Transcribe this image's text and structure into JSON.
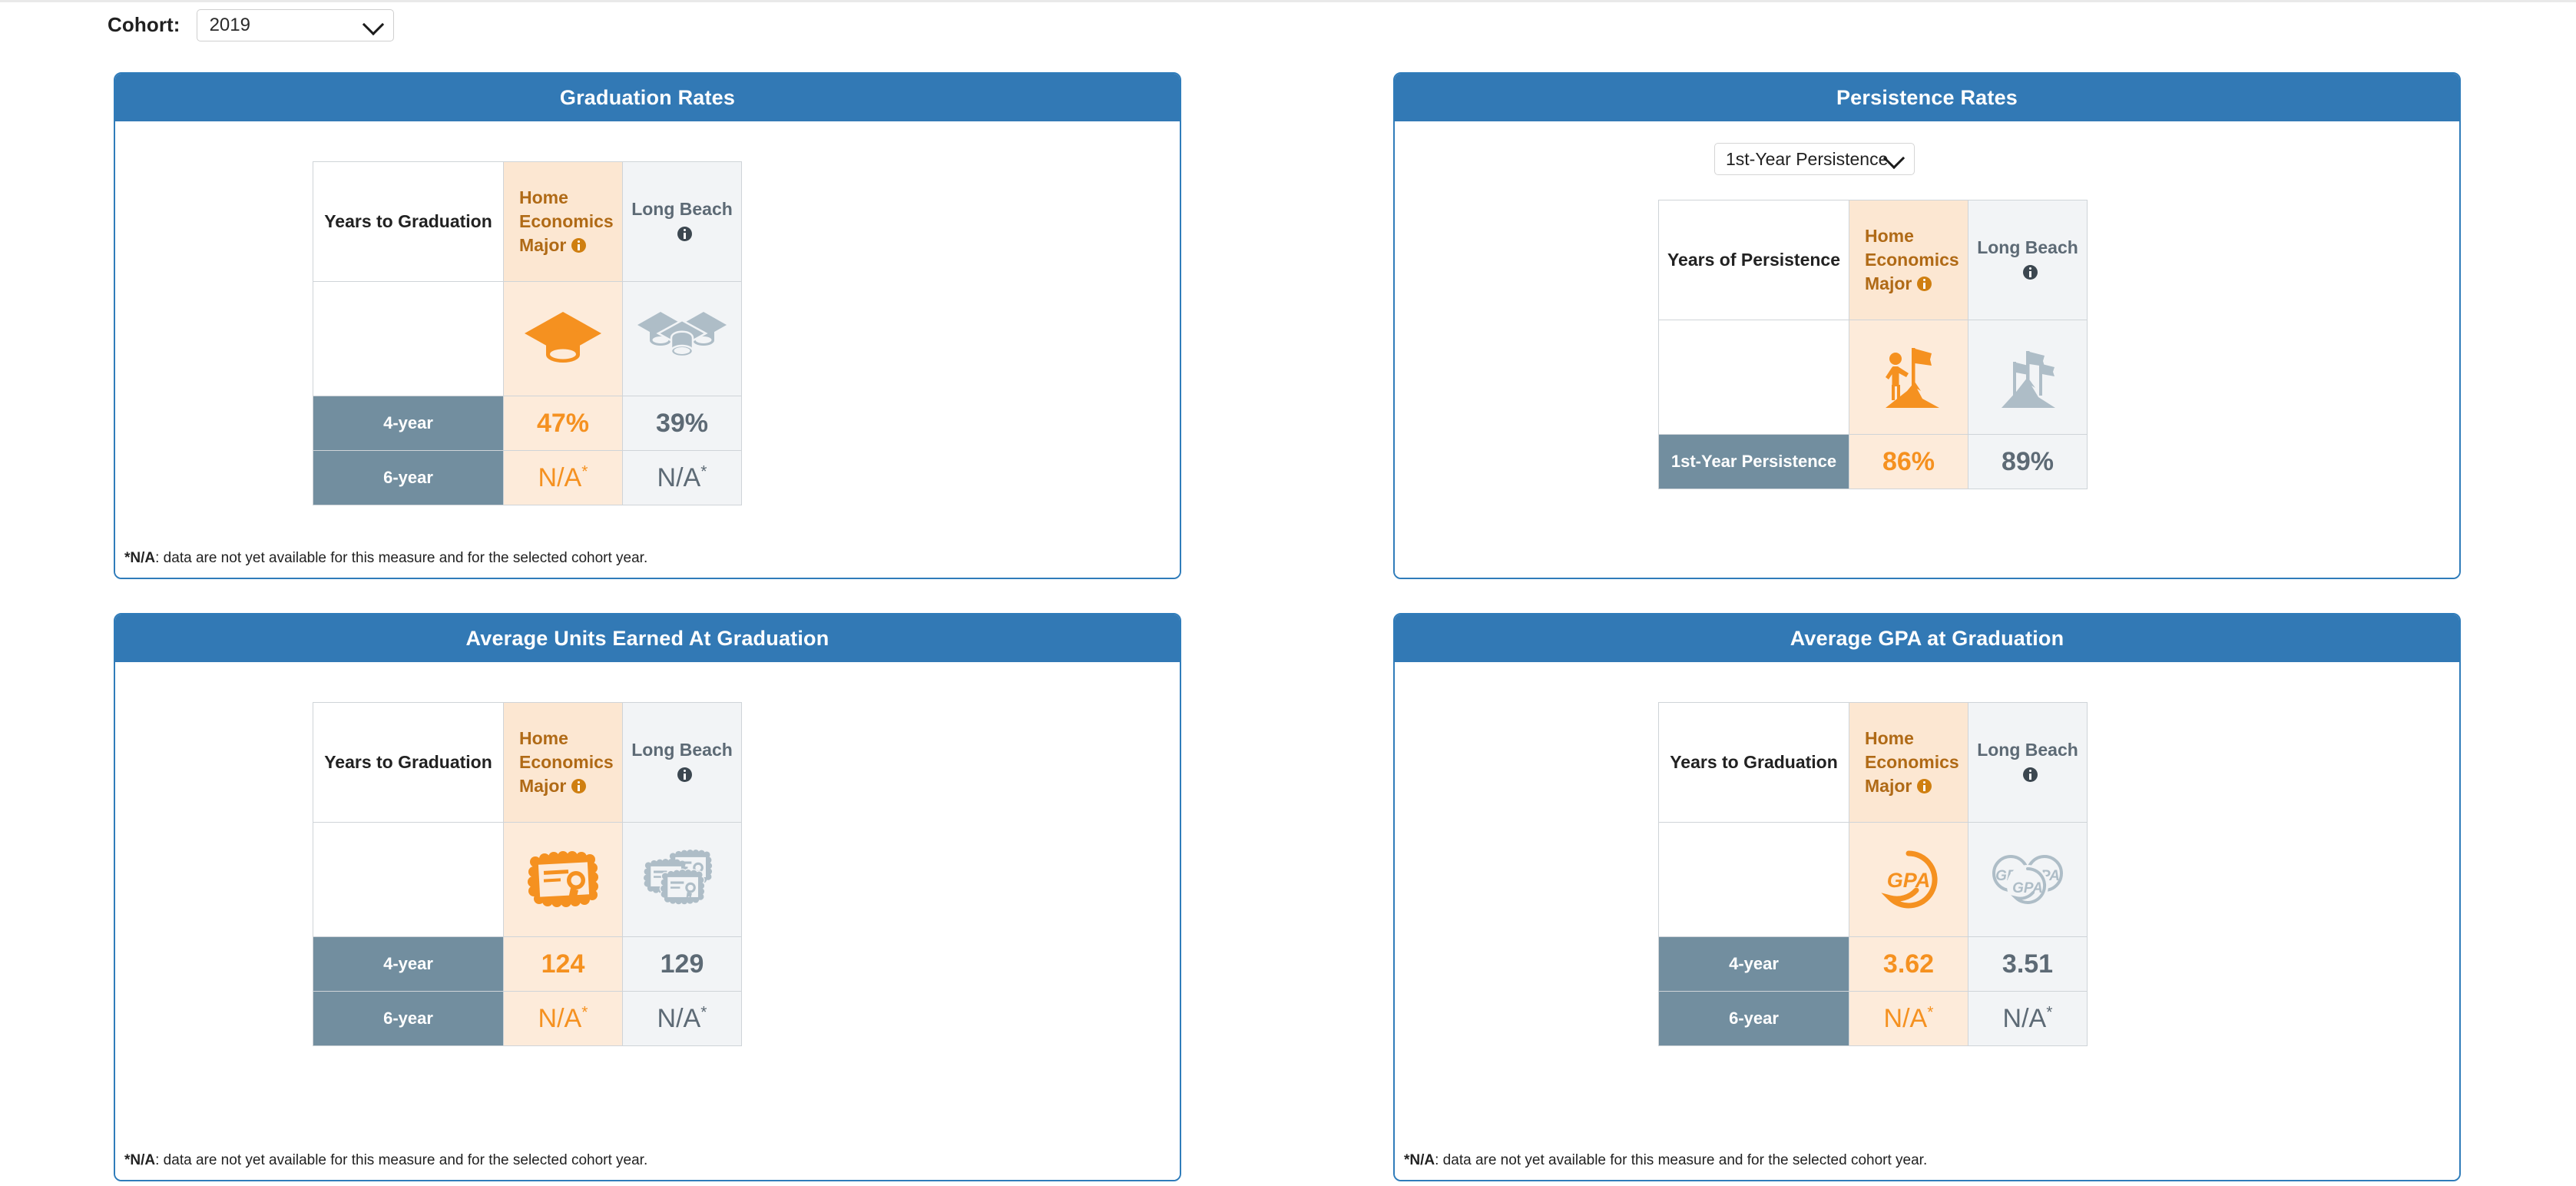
{
  "toolbar": {
    "cohort_label": "Cohort:",
    "cohort_value": "2019"
  },
  "footnote": {
    "marker": "*N/A",
    "text": ": data are not yet available for this measure and for the selected cohort year."
  },
  "colors": {
    "header_blue": "#3279b5",
    "card_border_blue": "#2f7cba",
    "accent_orange": "#f59120",
    "major_header_text": "#b06a16",
    "major_cell_bg": "#fdebda",
    "major_header_bg": "#fce7d2",
    "longbeach_bg": "#f2f4f6",
    "longbeach_text": "#5d6a75",
    "row_label_slate": "#728e9f"
  },
  "cards": {
    "graduation": {
      "title": "Graduation Rates",
      "col_label_header": "Years to Graduation",
      "col_major_header": "Home Economics Major",
      "col_longbeach_header": "Long Beach",
      "major_icon": "graduation-cap-icon",
      "longbeach_icon": "graduation-caps-group-icon",
      "rows": [
        {
          "label": "4-year",
          "major": "47%",
          "longbeach": "39%",
          "major_na": false,
          "lb_na": false
        },
        {
          "label": "6-year",
          "major": "N/A",
          "longbeach": "N/A",
          "major_na": true,
          "lb_na": true
        }
      ]
    },
    "persistence": {
      "title": "Persistence Rates",
      "measure_value": "1st-Year Persistence",
      "col_label_header": "Years of Persistence",
      "col_major_header": "Home Economics Major",
      "col_longbeach_header": "Long Beach",
      "major_icon": "hiker-flag-peak-icon",
      "longbeach_icon": "flags-peak-group-icon",
      "rows": [
        {
          "label": "1st-Year Persistence",
          "major": "86%",
          "longbeach": "89%",
          "major_na": false,
          "lb_na": false
        }
      ]
    },
    "units": {
      "title": "Average Units Earned At Graduation",
      "col_label_header": "Years to Graduation",
      "col_major_header": "Home Economics Major",
      "col_longbeach_header": "Long Beach",
      "major_icon": "diploma-certificate-icon",
      "longbeach_icon": "diploma-certificates-group-icon",
      "rows": [
        {
          "label": "4-year",
          "major": "124",
          "longbeach": "129",
          "major_na": false,
          "lb_na": false
        },
        {
          "label": "6-year",
          "major": "N/A",
          "longbeach": "N/A",
          "major_na": true,
          "lb_na": true
        }
      ]
    },
    "gpa": {
      "title": "Average GPA at Graduation",
      "col_label_header": "Years to Graduation",
      "col_major_header": "Home Economics Major",
      "col_longbeach_header": "Long Beach",
      "major_icon": "gpa-circle-icon",
      "longbeach_icon": "gpa-circles-group-icon",
      "icon_text": "GPA",
      "rows": [
        {
          "label": "4-year",
          "major": "3.62",
          "longbeach": "3.51",
          "major_na": false,
          "lb_na": false
        },
        {
          "label": "6-year",
          "major": "N/A",
          "longbeach": "N/A",
          "major_na": true,
          "lb_na": true
        }
      ]
    }
  }
}
